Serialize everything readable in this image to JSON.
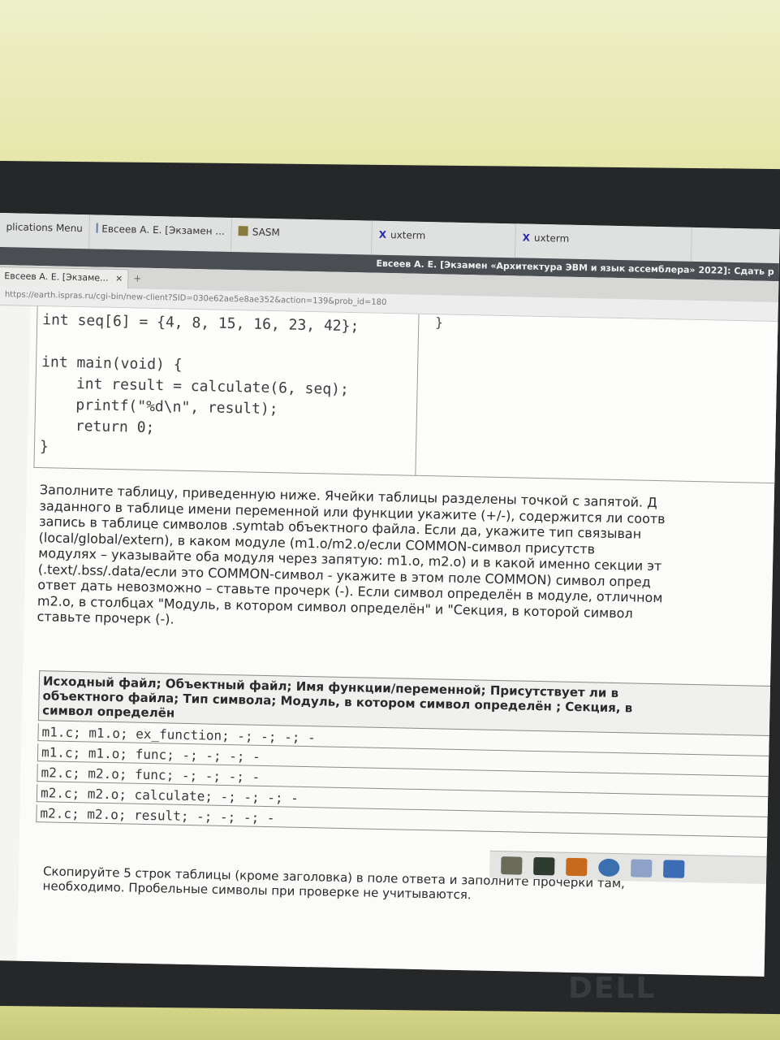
{
  "taskbar": {
    "items": [
      {
        "label": "plications Menu",
        "icon": "apps-menu-icon"
      },
      {
        "label": "Евсеев А. Е. [Экзамен ...",
        "icon": "browser-icon"
      },
      {
        "label": "SASM",
        "icon": "sasm-icon"
      },
      {
        "label": "uxterm",
        "icon": "x-icon"
      },
      {
        "label": "uxterm",
        "icon": "x-icon"
      }
    ]
  },
  "window": {
    "title": "Евсеев А. Е. [Экзамен «Архитектура ЭВМ и язык ассемблера» 2022]: Сдать р"
  },
  "browser": {
    "tab_label": "Евсеев А. Е. [Экзаме...",
    "tab_close": "×",
    "new_tab": "+",
    "url": "https://earth.ispras.ru/cgi-bin/new-client?SID=030e62ae5e8ae352&action=139&prob_id=180"
  },
  "code": {
    "left": "int seq[6] = {4, 8, 15, 16, 23, 42};\n\nint main(void) {\n    int result = calculate(6, seq);\n    printf(\"%d\\n\", result);\n    return 0;\n}",
    "right": "}"
  },
  "instructions": {
    "lines": [
      "Заполните таблицу, приведенную ниже. Ячейки таблицы разделены точкой с запятой. Д",
      "заданного в таблице имени переменной или функции укажите (+/-), содержится ли соотв",
      "запись в таблице символов .symtab объектного файла. Если да, укажите тип связыван",
      "(local/global/extern), в каком модуле (m1.o/m2.o/если COMMON-символ присутств",
      "модулях – указывайте оба модуля через запятую: m1.o, m2.o) и в какой именно секции эт",
      "(.text/.bss/.data/если это COMMON-символ - укажите в этом поле COMMON) символ опред",
      "ответ дать невозможно – ставьте прочерк (-). Если символ определён в модуле, отличном",
      "m2.o, в столбцах \"Модуль, в котором символ определён\" и \"Секция, в которой символ",
      "ставьте прочерк (-)."
    ]
  },
  "table": {
    "header_lines": [
      "Исходный файл; Объектный файл; Имя функции/переменной; Присутствует ли в",
      "объектного файла; Тип символа; Модуль, в котором символ определён ; Секция, в",
      "символ определён"
    ],
    "rows": [
      "m1.c; m1.o; ex_function; -; -; -; -",
      "m1.c; m1.o; func; -; -; -; -",
      "m2.c; m2.o; func; -; -; -; -",
      "m2.c; m2.o; calculate; -; -; -; -",
      "m2.c; m2.o; result; -; -; -; -"
    ]
  },
  "footer": {
    "lines": [
      "Скопируйте 5 строк таблицы (кроме заголовка) в поле ответа и заполните прочерки там,",
      "необходимо. Пробельные символы при проверке не учитываются."
    ]
  },
  "panel": {
    "icons": [
      "monitor-icon",
      "terminal-icon",
      "files-icon",
      "globe-icon",
      "search-icon",
      "folder-icon"
    ],
    "colors": [
      "#6b6b5a",
      "#2f3b2f",
      "#c86a1e",
      "#3a6fb0",
      "#8ea2c8",
      "#3b6cb5"
    ]
  },
  "brand": {
    "logo": "DELL"
  }
}
